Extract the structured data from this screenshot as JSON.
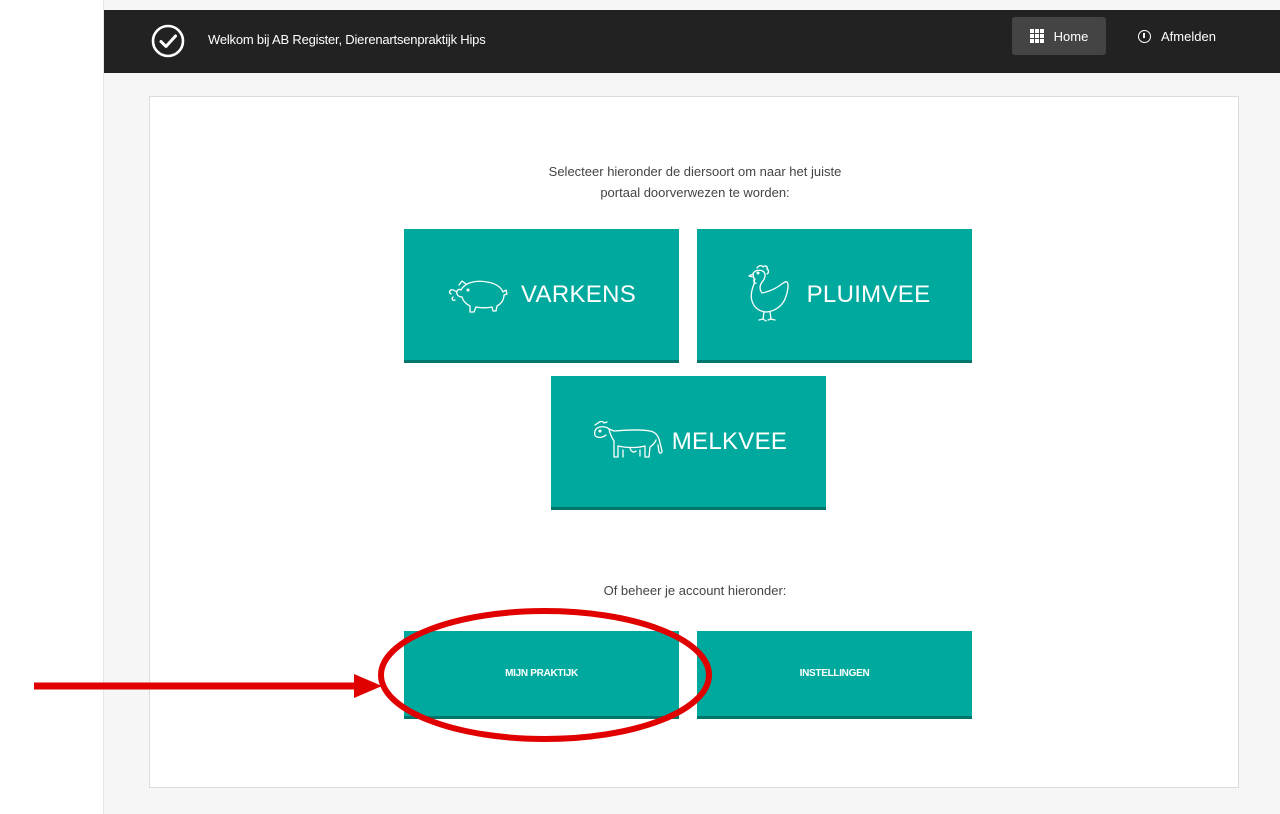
{
  "header": {
    "welcome_text": "Welkom bij AB Register, Dierenartsenpraktijk Hips",
    "nav": {
      "home_label": "Home",
      "logout_label": "Afmelden"
    }
  },
  "main": {
    "intro_line1": "Selecteer hieronder de diersoort om naar het juiste",
    "intro_line2": "portaal doorverwezen te worden:",
    "species_tiles": [
      {
        "label": "VARKENS",
        "icon": "pig-icon"
      },
      {
        "label": "PLUIMVEE",
        "icon": "chicken-icon"
      },
      {
        "label": "MELKVEE",
        "icon": "cow-icon"
      }
    ],
    "account_text": "Of beheer je account hieronder:",
    "account_buttons": [
      {
        "label": "MIJN PRAKTIJK"
      },
      {
        "label": "INSTELLINGEN"
      }
    ]
  },
  "colors": {
    "topbar": "#222222",
    "accent": "#00a99d",
    "accent_dark": "#00766d",
    "annotation": "#e00000"
  },
  "icons": [
    "check-circle-icon",
    "grid-icon",
    "info-icon",
    "pig-icon",
    "chicken-icon",
    "cow-icon"
  ]
}
